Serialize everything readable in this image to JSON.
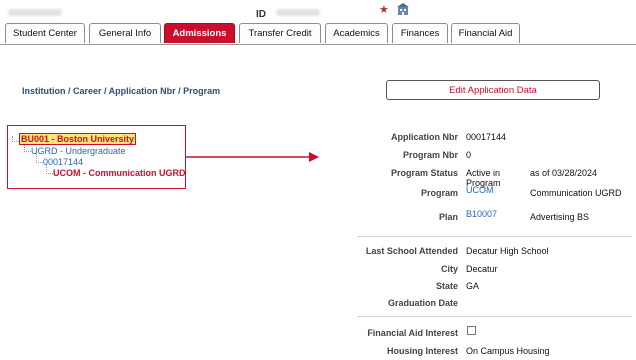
{
  "header": {
    "id_label": "ID",
    "star_icon": "favorite-star-icon",
    "home_icon": "building-icon",
    "colors": {
      "accent": "#c8102e",
      "link": "#2a67b0"
    }
  },
  "tabs": [
    {
      "label": "Student Center",
      "active": false
    },
    {
      "label": "General Info",
      "active": false
    },
    {
      "label": "Admissions",
      "active": true
    },
    {
      "label": "Transfer Credit",
      "active": false
    },
    {
      "label": "Academics",
      "active": false
    },
    {
      "label": "Finances",
      "active": false
    },
    {
      "label": "Financial Aid",
      "active": false
    }
  ],
  "breadcrumb": "Institution / Career / Application Nbr / Program",
  "edit_button": "Edit Application Data",
  "tree": {
    "institution": "BU001 - Boston University",
    "career": "UGRD - Undergraduate",
    "application": "00017144",
    "program": "UCOM - Communication UGRD"
  },
  "details": {
    "application_nbr": {
      "label": "Application Nbr",
      "value": "00017144"
    },
    "program_nbr": {
      "label": "Program Nbr",
      "value": "0"
    },
    "program_status": {
      "label": "Program Status",
      "value_line1": "Active in",
      "value_line2": "Program",
      "as_of": "as of 03/28/2024"
    },
    "program": {
      "label": "Program",
      "code": "UCOM",
      "description": "Communication UGRD"
    },
    "plan": {
      "label": "Plan",
      "code": "B10007",
      "description": "Advertising BS"
    },
    "last_school": {
      "label": "Last School Attended",
      "value": "Decatur High School"
    },
    "city": {
      "label": "City",
      "value": "Decatur"
    },
    "state": {
      "label": "State",
      "value": "GA"
    },
    "graduation_date": {
      "label": "Graduation Date",
      "value": ""
    },
    "financial_aid_interest": {
      "label": "Financial Aid Interest",
      "checked": false
    },
    "housing_interest": {
      "label": "Housing Interest",
      "value": "On Campus Housing"
    }
  }
}
